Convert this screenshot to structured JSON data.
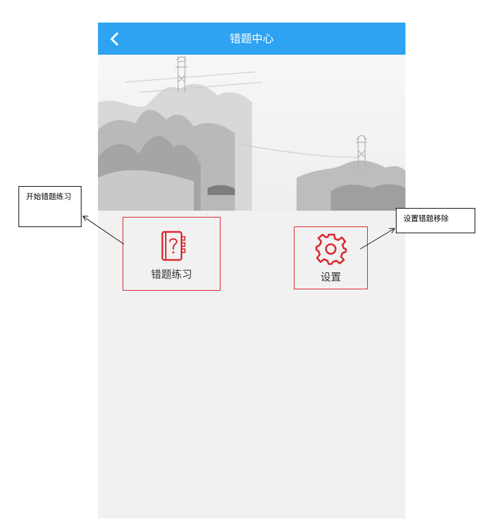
{
  "header": {
    "title": "错题中心",
    "back_icon": "chevron-left-icon"
  },
  "tiles": [
    {
      "label": "错题练习",
      "icon": "question-notebook-icon"
    },
    {
      "label": "设置",
      "icon": "gear-icon"
    }
  ],
  "annotations": {
    "practice": "开始错题练习",
    "settings": "设置错题移除"
  },
  "colors": {
    "header": "#2ea3f2",
    "accent": "#d9292e",
    "background": "#f1f1f1"
  }
}
